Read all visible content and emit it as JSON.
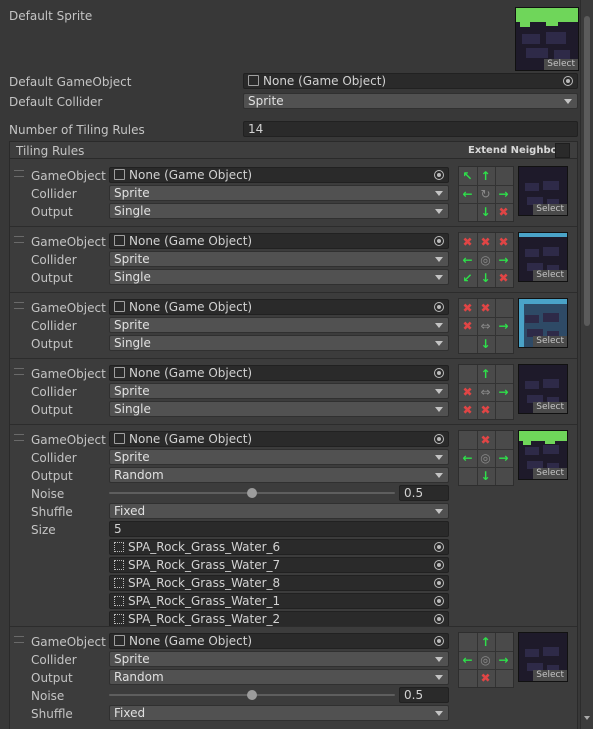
{
  "header": {
    "default_sprite_label": "Default Sprite",
    "select_label": "Select",
    "default_gameobject_label": "Default GameObject",
    "default_gameobject_value": "None (Game Object)",
    "default_collider_label": "Default Collider",
    "default_collider_value": "Sprite",
    "num_rules_label": "Number of Tiling Rules",
    "num_rules_value": "14"
  },
  "rules_section": {
    "title": "Tiling Rules",
    "extend_neighbor_label": "Extend Neighbor"
  },
  "labels": {
    "gameobject": "GameObject",
    "collider": "Collider",
    "output": "Output",
    "noise": "Noise",
    "shuffle": "Shuffle",
    "size": "Size"
  },
  "rules": [
    {
      "gameobject": "None (Game Object)",
      "collider": "Sprite",
      "output": "Single"
    },
    {
      "gameobject": "None (Game Object)",
      "collider": "Sprite",
      "output": "Single"
    },
    {
      "gameobject": "None (Game Object)",
      "collider": "Sprite",
      "output": "Single"
    },
    {
      "gameobject": "None (Game Object)",
      "collider": "Sprite",
      "output": "Single"
    },
    {
      "gameobject": "None (Game Object)",
      "collider": "Sprite",
      "output": "Random",
      "noise": "0.5",
      "noise_fraction": 0.5,
      "shuffle": "Fixed",
      "size": "5",
      "sprites": [
        "SPA_Rock_Grass_Water_6",
        "SPA_Rock_Grass_Water_7",
        "SPA_Rock_Grass_Water_8",
        "SPA_Rock_Grass_Water_1",
        "SPA_Rock_Grass_Water_2"
      ]
    },
    {
      "gameobject": "None (Game Object)",
      "collider": "Sprite",
      "output": "Random",
      "noise": "0.5",
      "noise_fraction": 0.5,
      "shuffle": "Fixed"
    }
  ],
  "colors": {
    "background": "#383838",
    "field": "#2a2a2a",
    "dropdown": "#515151",
    "arrow_green": "#2ee04a",
    "cross_red": "#e04545"
  }
}
